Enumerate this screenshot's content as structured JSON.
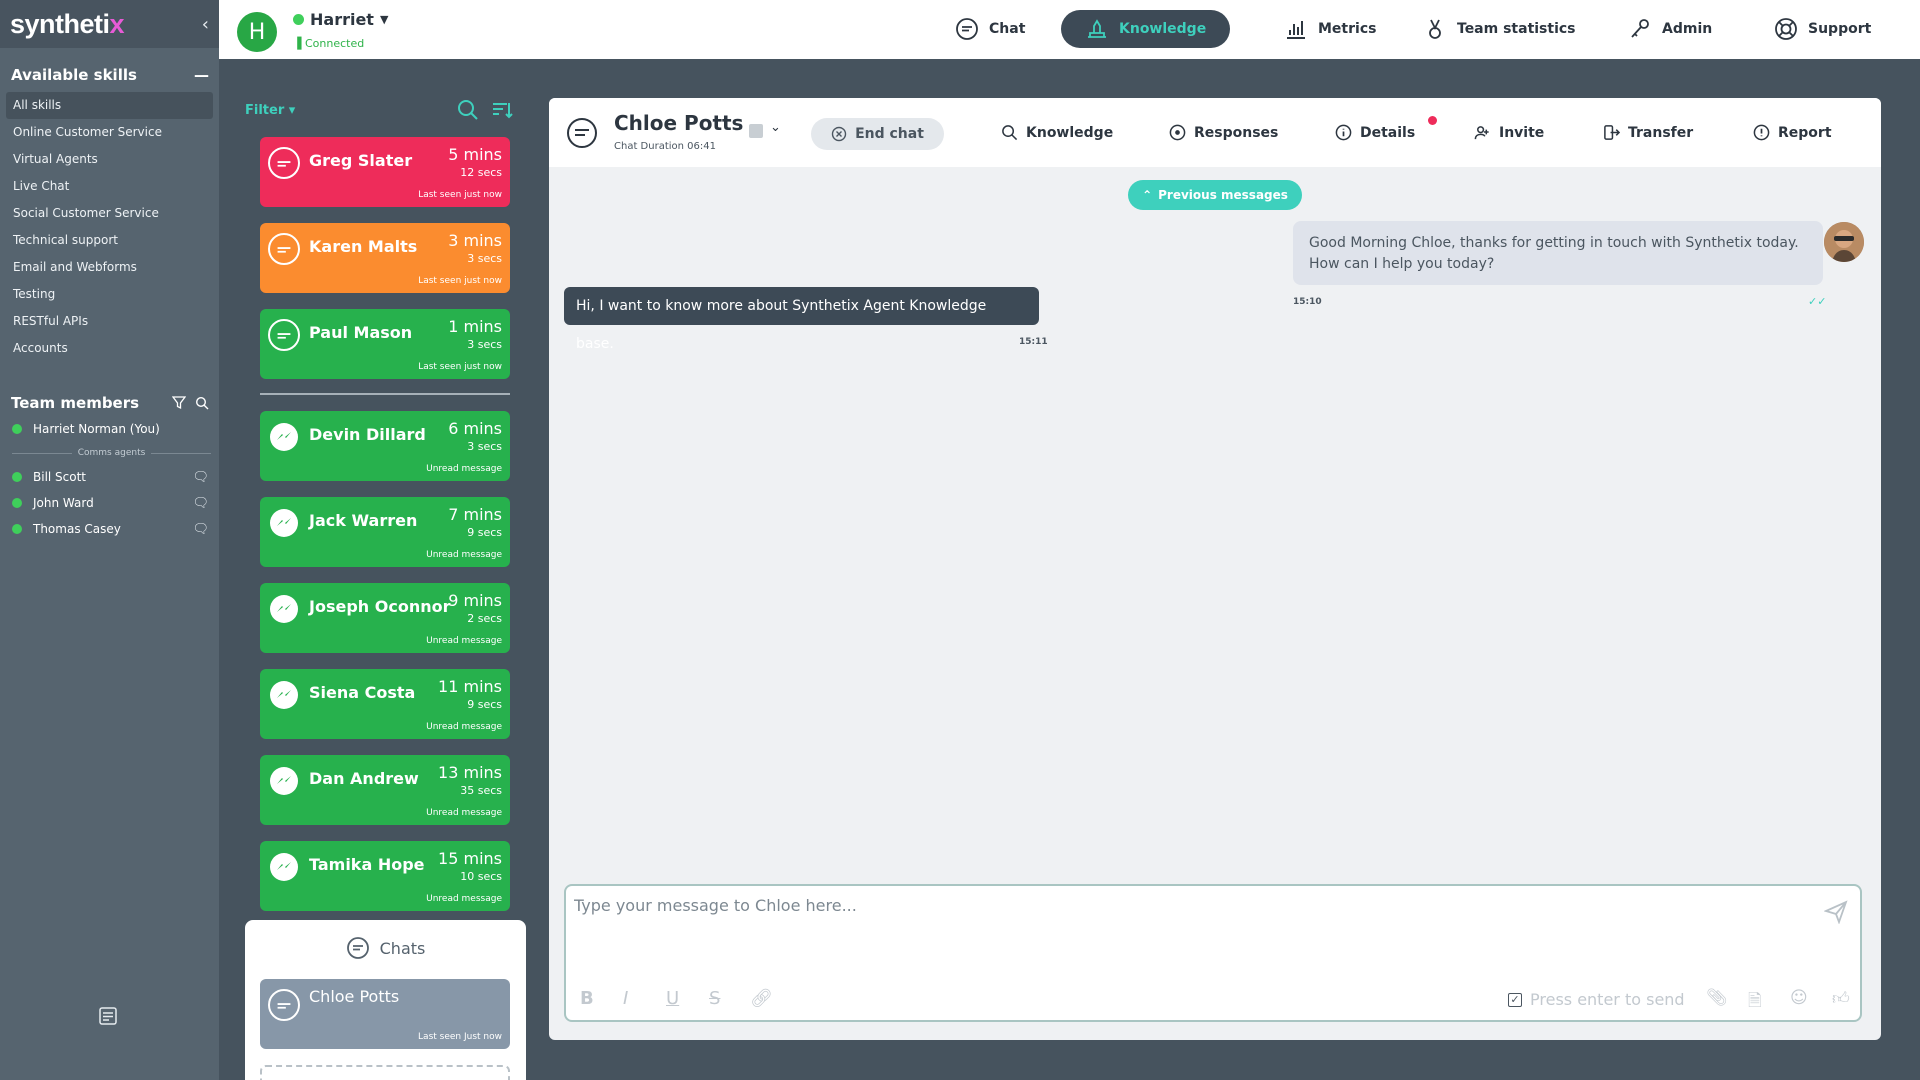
{
  "app": {
    "logo_main": "syntheti",
    "logo_accent": "x"
  },
  "sidebar": {
    "skills_title": "Available skills",
    "skills": [
      "All skills",
      "Online Customer Service",
      "Virtual Agents",
      "Live Chat",
      "Social Customer Service",
      "Technical support",
      "Email and Webforms",
      "Testing",
      "RESTful APIs",
      "Accounts"
    ],
    "team_title": "Team members",
    "self_member": "Harriet Norman (You)",
    "group_label": "Comms agents",
    "members": [
      "Bill Scott",
      "John Ward",
      "Thomas Casey"
    ]
  },
  "agent": {
    "initial": "H",
    "name": "Harriet",
    "status": "Connected"
  },
  "nav": {
    "chat": "Chat",
    "knowledge": "Knowledge",
    "metrics": "Metrics",
    "team_statistics": "Team statistics",
    "admin": "Admin",
    "support": "Support"
  },
  "queue": {
    "filter_label": "Filter",
    "cards": [
      {
        "name": "Greg Slater",
        "mins": "5 mins",
        "secs": "12 secs",
        "status": "Last seen just now",
        "color": "#ee2c5a",
        "channel": "chat"
      },
      {
        "name": "Karen Malts",
        "mins": "3 mins",
        "secs": "3 secs",
        "status": "Last seen just now",
        "color": "#fb8c2f",
        "channel": "chat"
      },
      {
        "name": "Paul Mason",
        "mins": "1 mins",
        "secs": "3 secs",
        "status": "Last seen just now",
        "color": "#27b14d",
        "channel": "chat"
      },
      {
        "name": "Devin Dillard",
        "mins": "6 mins",
        "secs": "3 secs",
        "status": "Unread message",
        "color": "#27b14d",
        "channel": "messenger"
      },
      {
        "name": "Jack Warren",
        "mins": "7 mins",
        "secs": "9 secs",
        "status": "Unread message",
        "color": "#27b14d",
        "channel": "messenger"
      },
      {
        "name": "Joseph Oconnor",
        "mins": "9 mins",
        "secs": "2 secs",
        "status": "Unread message",
        "color": "#27b14d",
        "channel": "messenger"
      },
      {
        "name": "Siena Costa",
        "mins": "11 mins",
        "secs": "9 secs",
        "status": "Unread message",
        "color": "#27b14d",
        "channel": "messenger"
      },
      {
        "name": "Dan Andrew",
        "mins": "13 mins",
        "secs": "35 secs",
        "status": "Unread message",
        "color": "#27b14d",
        "channel": "messenger"
      },
      {
        "name": "Tamika Hope",
        "mins": "15 mins",
        "secs": "10 secs",
        "status": "Unread message",
        "color": "#27b14d",
        "channel": "messenger"
      }
    ],
    "chats_title": "Chats",
    "active_chat": {
      "name": "Chloe Potts",
      "status": "Last seen Just now"
    }
  },
  "chat": {
    "customer_name": "Chloe Potts",
    "duration": "Chat Duration 06:41",
    "end_chat": "End chat",
    "actions": {
      "knowledge": "Knowledge",
      "responses": "Responses",
      "details": "Details",
      "invite": "Invite",
      "transfer": "Transfer",
      "report": "Report"
    },
    "previous_messages": "Previous messages",
    "messages": {
      "agent_text": "Good Morning Chloe, thanks for getting in touch with Synthetix today. How can I help you today?",
      "agent_time": "15:10",
      "customer_text": "Hi, I want to know more about Synthetix Agent Knowledge base.",
      "customer_time": "15:11"
    },
    "composer": {
      "placeholder": "Type your message to Chloe here...",
      "press_enter": "Press enter to send"
    }
  },
  "colors": {
    "accent": "#3ed0bd",
    "dark": "#3d4a56",
    "online": "#3fcf5b"
  }
}
